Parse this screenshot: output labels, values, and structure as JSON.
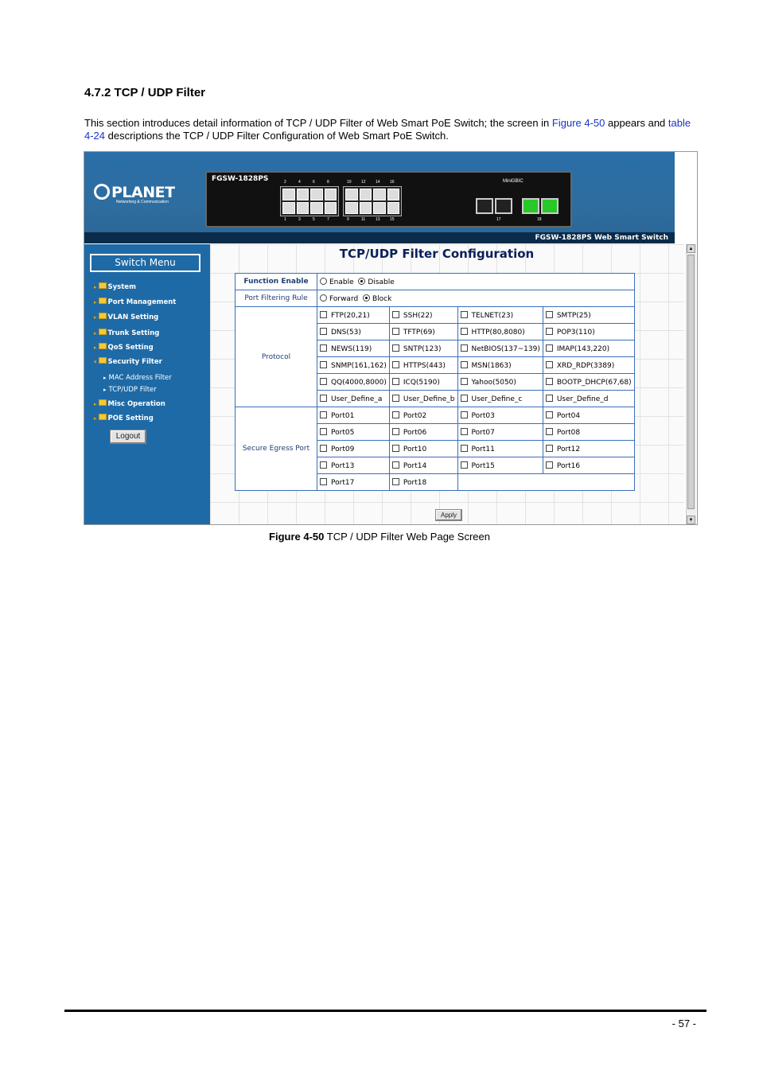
{
  "heading": "4.7.2 TCP / UDP Filter",
  "intro": {
    "part1": "This section introduces detail information of TCP / UDP Filter of Web Smart PoE Switch; the screen in ",
    "link1": "Figure 4-50",
    "part2": " appears and ",
    "link2": "table 4-24",
    "part3": " descriptions the TCP / UDP Filter Configuration of Web Smart PoE Switch."
  },
  "screenshot": {
    "banner": {
      "logo_text": "PLANET",
      "logo_sub": "Networking & Communication",
      "device_model": "FGSW-1828PS",
      "banner_title": "FGSW-1828PS Web Smart Switch",
      "minigbic_label": "MiniGBIC",
      "port_numbers_top": [
        "2",
        "4",
        "6",
        "8",
        "10",
        "12",
        "14",
        "16"
      ],
      "port_numbers_bottom": [
        "1",
        "3",
        "5",
        "7",
        "9",
        "11",
        "13",
        "15"
      ],
      "sfp_labels": [
        "17",
        "18"
      ]
    },
    "menu": {
      "title": "Switch Menu",
      "items": [
        "System",
        "Port Management",
        "VLAN Setting",
        "Trunk Setting",
        "QoS Setting",
        "Security Filter"
      ],
      "security_sub": [
        "MAC Address Filter",
        "TCP/UDP Filter"
      ],
      "items_after": [
        "Misc Operation",
        "POE Setting"
      ],
      "logout": "Logout"
    },
    "page_title": "TCP/UDP Filter Configuration",
    "function_enable": {
      "label": "Function Enable",
      "options": [
        "Enable",
        "Disable"
      ],
      "selected": "Disable"
    },
    "port_filtering_rule": {
      "label": "Port Filtering Rule",
      "options": [
        "Forward",
        "Block"
      ],
      "selected": "Block"
    },
    "protocol": {
      "label": "Protocol",
      "rows": [
        [
          "FTP(20,21)",
          "SSH(22)",
          "TELNET(23)",
          "SMTP(25)"
        ],
        [
          "DNS(53)",
          "TFTP(69)",
          "HTTP(80,8080)",
          "POP3(110)"
        ],
        [
          "NEWS(119)",
          "SNTP(123)",
          "NetBIOS(137~139)",
          "IMAP(143,220)"
        ],
        [
          "SNMP(161,162)",
          "HTTPS(443)",
          "MSN(1863)",
          "XRD_RDP(3389)"
        ],
        [
          "QQ(4000,8000)",
          "ICQ(5190)",
          "Yahoo(5050)",
          "BOOTP_DHCP(67,68)"
        ],
        [
          "User_Define_a",
          "User_Define_b",
          "User_Define_c",
          "User_Define_d"
        ]
      ]
    },
    "secure_egress": {
      "label": "Secure Egress Port",
      "rows": [
        [
          "Port01",
          "Port02",
          "Port03",
          "Port04"
        ],
        [
          "Port05",
          "Port06",
          "Port07",
          "Port08"
        ],
        [
          "Port09",
          "Port10",
          "Port11",
          "Port12"
        ],
        [
          "Port13",
          "Port14",
          "Port15",
          "Port16"
        ],
        [
          "Port17",
          "Port18"
        ]
      ]
    },
    "apply": "Apply"
  },
  "caption": {
    "bold": "Figure 4-50",
    "text": " TCP / UDP Filter Web Page Screen"
  },
  "page_number": "- 57 -",
  "colors": {
    "link": "#1a33cc",
    "sidebar": "#1e6aa6",
    "table_border": "#3a6fb8",
    "title": "#0a1f5a"
  }
}
